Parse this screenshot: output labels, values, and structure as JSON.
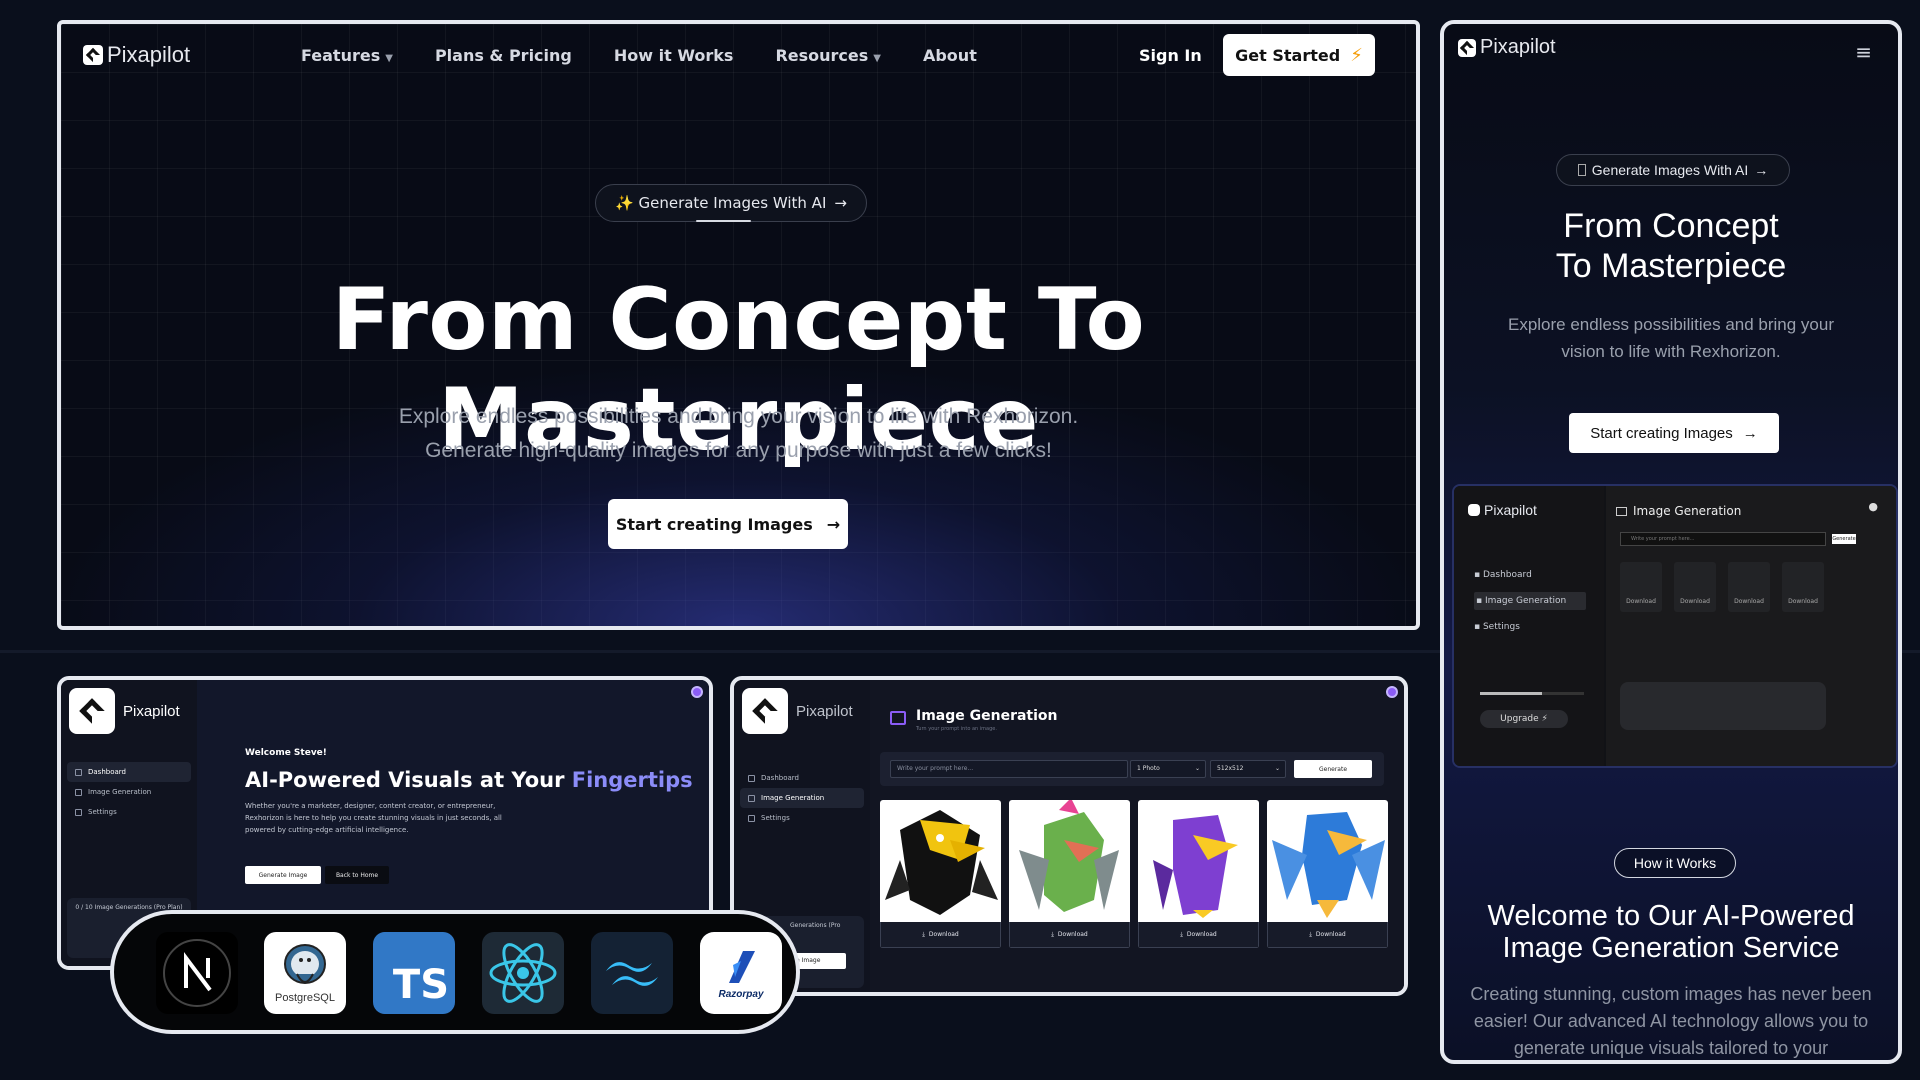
{
  "brand": {
    "name": "Pixapilot"
  },
  "hero": {
    "nav": {
      "links": [
        {
          "label": "Features",
          "dropdown": true
        },
        {
          "label": "Plans & Pricing",
          "dropdown": false
        },
        {
          "label": "How it Works",
          "dropdown": false
        },
        {
          "label": "Resources",
          "dropdown": true
        },
        {
          "label": "About",
          "dropdown": false
        }
      ],
      "sign_in": "Sign In",
      "get_started": "Get Started"
    },
    "pill": "✨ Generate Images With AI",
    "title": "From Concept To Masterpiece",
    "subtitle_line1": "Explore endless possibilities and bring your vision to life with Rexhorizon.",
    "subtitle_line2": "Generate high-quality images for any purpose with just a few clicks!",
    "cta": "Start creating Images"
  },
  "mobile": {
    "pill": "Generate Images With AI",
    "title_line1": "From Concept",
    "title_line2": "To Masterpiece",
    "subtitle": "Explore endless possibilities and bring your vision to life with Rexhorizon.",
    "cta": "Start creating Images",
    "dash": {
      "title": "Image Generation",
      "prompt_placeholder": "Write your prompt here...",
      "generate": "Generate",
      "menu": [
        "Dashboard",
        "Image Generation",
        "Settings"
      ],
      "download": "Download",
      "upgrade": "Upgrade"
    },
    "how_pill": "How it Works",
    "h2_line1": "Welcome to Our AI-Powered",
    "h2_line2": "Image Generation Service",
    "paragraph": "Creating stunning, custom images has never been easier! Our advanced AI technology allows you to generate unique visuals tailored to your"
  },
  "dashboard_home": {
    "menu": [
      "Dashboard",
      "Image Generation",
      "Settings"
    ],
    "welcome": "Welcome Steve!",
    "title_prefix": "AI-Powered Visuals at Your ",
    "title_highlight": "Fingertips",
    "desc_line1": "Whether you're a marketer, designer, content creator, or entrepreneur,",
    "desc_line2": "Rexhorizon is here to help you create stunning visuals in just seconds, all",
    "desc_line3": "powered by cutting-edge artificial intelligence.",
    "generate_btn": "Generate Image",
    "home_btn": "Back to Home",
    "quota": "0 / 10 Image Generations (Pro Plan)"
  },
  "dashboard_gen": {
    "menu": [
      "Dashboard",
      "Image Generation",
      "Settings"
    ],
    "title": "Image Generation",
    "subtitle": "Turn your prompt into an image.",
    "prompt_placeholder": "Write your prompt here...",
    "count": "1 Photo",
    "size": "512x512",
    "generate": "Generate",
    "download": "Download",
    "quota": "Generations (Pro",
    "quota_btn": "e Image"
  },
  "tech_stack": [
    {
      "name": "next-js-icon"
    },
    {
      "name": "postgresql-icon",
      "label": "PostgreSQL"
    },
    {
      "name": "typescript-icon",
      "label": "TS"
    },
    {
      "name": "react-icon"
    },
    {
      "name": "tailwind-icon"
    },
    {
      "name": "razorpay-icon",
      "label": "Razorpay"
    }
  ],
  "colors": {
    "background": "#0a0f1c",
    "accent": "#8b8cf8",
    "lightning": "#f59e0b",
    "typescript": "#3178c6"
  }
}
